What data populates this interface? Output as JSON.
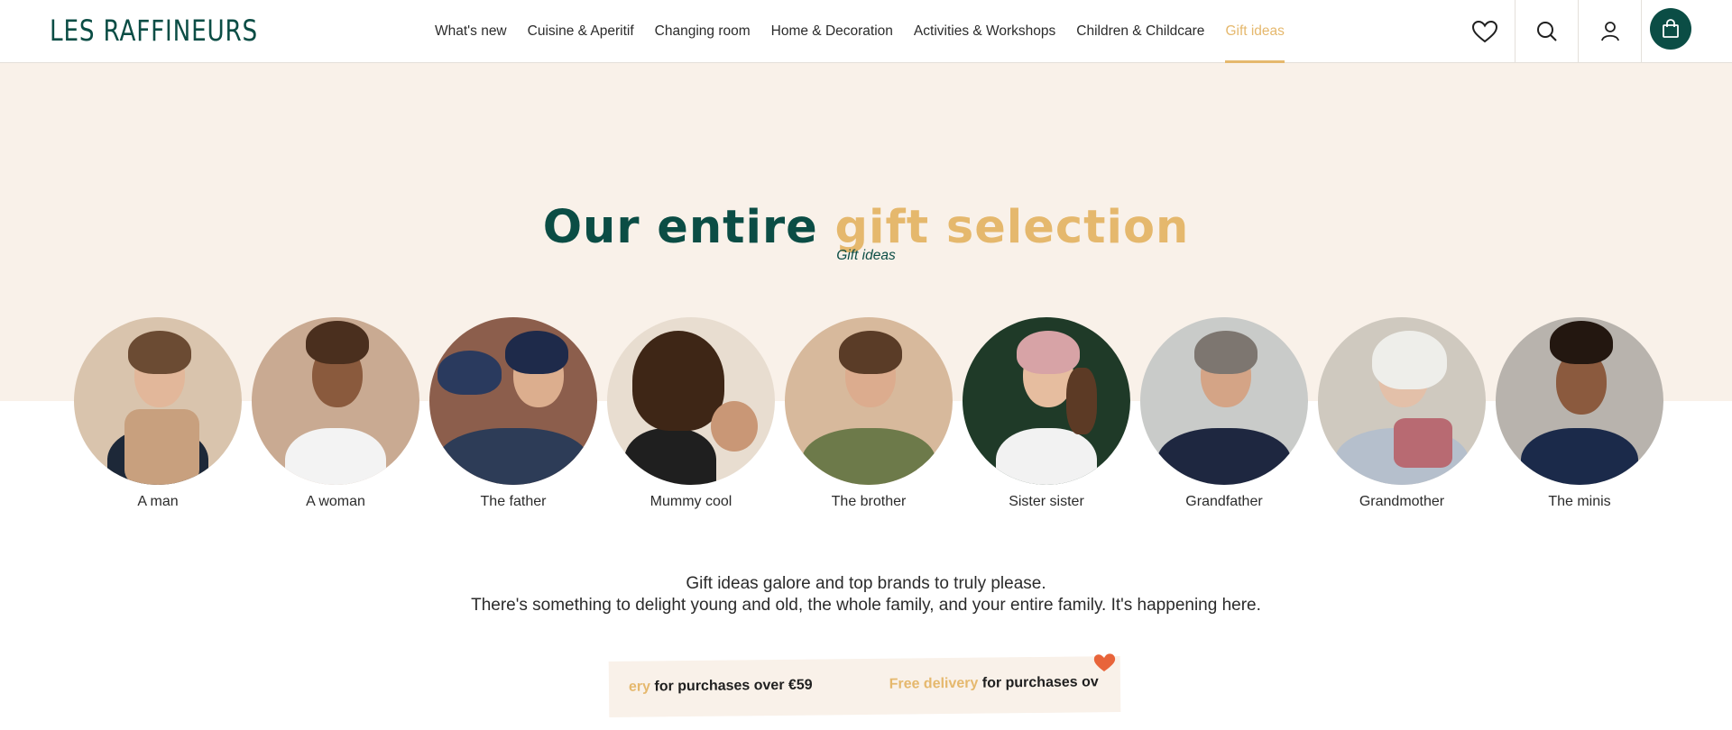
{
  "brand": {
    "logo": "LES RAFFINEURS"
  },
  "nav": {
    "items": [
      {
        "label": "What's new"
      },
      {
        "label": "Cuisine & Aperitif"
      },
      {
        "label": "Changing room"
      },
      {
        "label": "Home & Decoration"
      },
      {
        "label": "Activities & Workshops"
      },
      {
        "label": "Children & Childcare"
      },
      {
        "label": "Gift ideas",
        "active": true
      }
    ]
  },
  "header_icons": [
    "heart-icon",
    "search-icon",
    "user-icon",
    "shopping-bag-icon"
  ],
  "hero": {
    "title_part1": "Our entire",
    "title_part2": "gift selection",
    "subtitle": "Gift ideas"
  },
  "categories": [
    {
      "label": "A man"
    },
    {
      "label": "A woman"
    },
    {
      "label": "The father"
    },
    {
      "label": "Mummy cool"
    },
    {
      "label": "The brother"
    },
    {
      "label": "Sister sister"
    },
    {
      "label": "Grandfather"
    },
    {
      "label": "Grandmother"
    },
    {
      "label": "The minis"
    }
  ],
  "tagline": {
    "line1": "Gift ideas galore and top brands to truly please.",
    "line2": "There's something to delight young and old, the whole family, and your entire family. It's happening here."
  },
  "banner": {
    "seg1_highlight": "ery",
    "seg1_text": " for purchases over €59",
    "seg2_highlight": "Free delivery",
    "seg2_text": " for purchases ov"
  },
  "colors": {
    "primary": "#0b4d45",
    "accent": "#e5b86d",
    "hero_bg": "#f9f1e9"
  }
}
